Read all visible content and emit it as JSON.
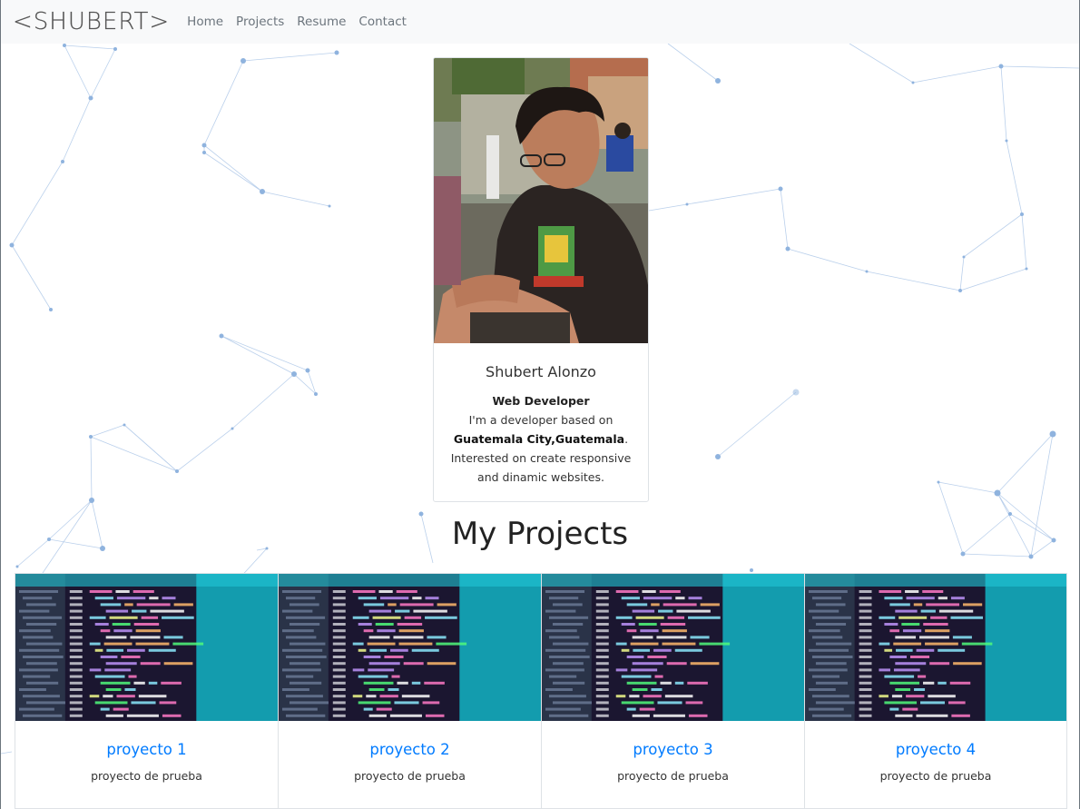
{
  "navbar": {
    "brand": "<SHUBERT>",
    "links": [
      {
        "label": "Home"
      },
      {
        "label": "Projects"
      },
      {
        "label": "Resume"
      },
      {
        "label": "Contact"
      }
    ]
  },
  "profile": {
    "name": "Shubert Alonzo",
    "role": "Web Developer",
    "text_pre": "I'm a developer based on",
    "location": "Guatemala City,Guatemala",
    "text_post": ". Interested on create responsive and dinamic websites."
  },
  "projects_section": {
    "title": "My Projects",
    "cards": [
      {
        "title": "proyecto 1",
        "description": "proyecto de prueba"
      },
      {
        "title": "proyecto 2",
        "description": "proyecto de prueba"
      },
      {
        "title": "proyecto 3",
        "description": "proyecto de prueba"
      },
      {
        "title": "proyecto 4",
        "description": "proyecto de prueba"
      }
    ]
  },
  "colors": {
    "link": "#007bff",
    "navbar_bg": "#f8f9fa",
    "particle": "#8fb3de"
  }
}
